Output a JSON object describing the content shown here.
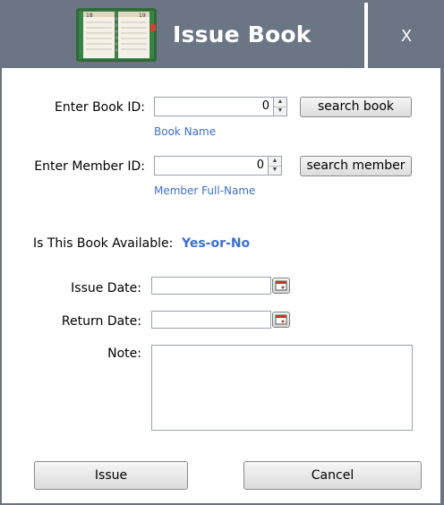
{
  "window": {
    "title": "Issue Book",
    "close_label": "X",
    "icon": "calendar-book-icon"
  },
  "form": {
    "book_id_label": "Enter Book ID:",
    "book_id_value": "0",
    "search_book_label": "search book",
    "book_name_link": "Book Name",
    "member_id_label": "Enter Member ID:",
    "member_id_value": "0",
    "search_member_label": "search member",
    "member_name_link": "Member Full-Name",
    "available_label": "Is This Book Available:",
    "available_value": "Yes-or-No",
    "issue_date_label": "Issue Date:",
    "issue_date_value": "",
    "return_date_label": "Return Date:",
    "return_date_value": "",
    "note_label": "Note:",
    "note_value": ""
  },
  "actions": {
    "issue_label": "Issue",
    "cancel_label": "Cancel"
  },
  "colors": {
    "titlebar": "#6b7584",
    "link": "#3c6fd0"
  }
}
